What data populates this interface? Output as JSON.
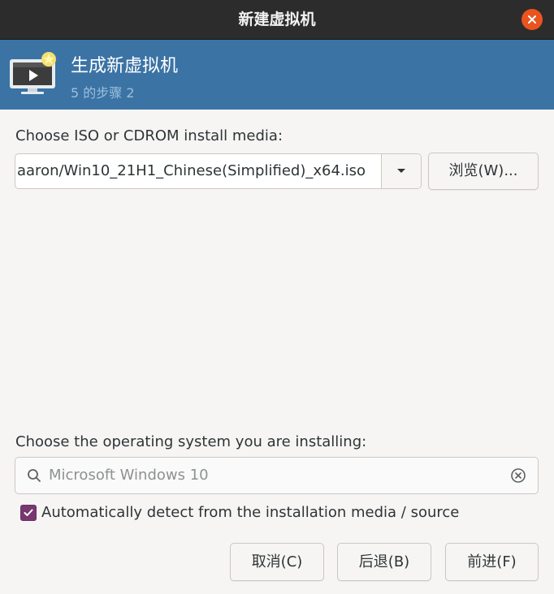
{
  "window": {
    "title": "新建虚拟机",
    "close_icon": "close-icon",
    "close_color": "#e95420"
  },
  "header": {
    "title": "生成新虚拟机",
    "step": "5 的步骤 2",
    "icon": "virtual-machine-monitor-icon",
    "background": "#3b73a5"
  },
  "install_media": {
    "label": "Choose ISO or CDROM install media:",
    "path_value": "aaron/Win10_21H1_Chinese(Simplified)_x64.iso",
    "dropdown_icon": "chevron-down-icon",
    "browse_label": "浏览(W)..."
  },
  "os_selection": {
    "label": "Choose the operating system you are installing:",
    "search_value": "Microsoft Windows 10",
    "search_icon": "search-icon",
    "clear_icon": "clear-icon",
    "auto_detect_label": "Automatically detect from the installation media / source",
    "auto_detect_checked": true,
    "checkbox_color": "#77386f"
  },
  "footer": {
    "cancel_label": "取消(C)",
    "back_label": "后退(B)",
    "forward_label": "前进(F)"
  }
}
